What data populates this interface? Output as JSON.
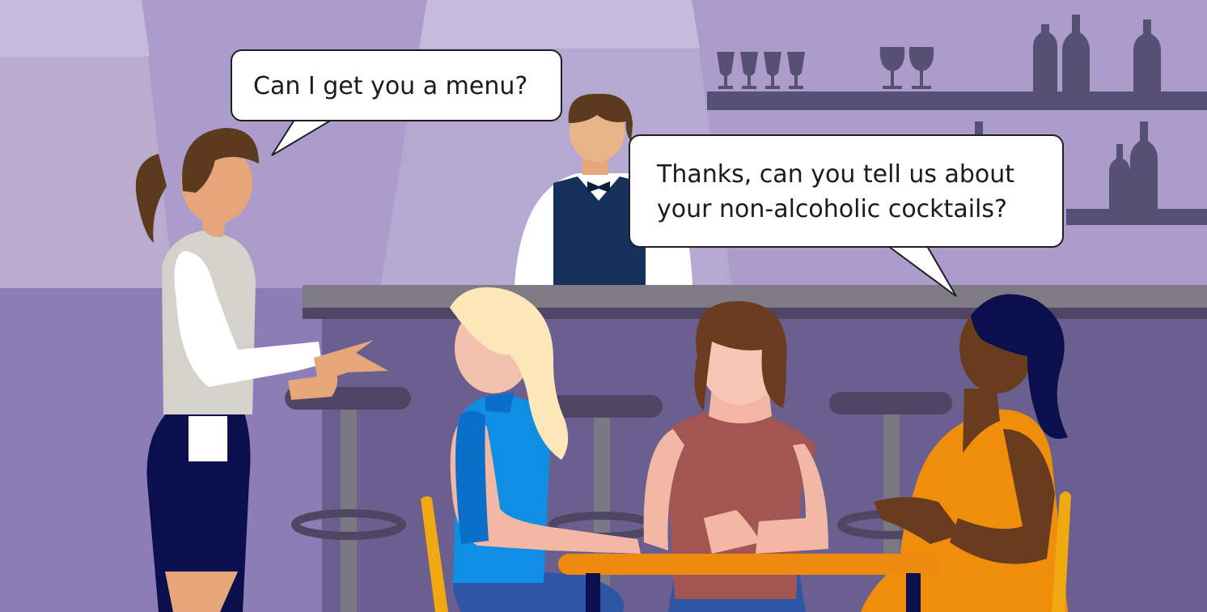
{
  "speech": {
    "waitress": "Can I get you a menu?",
    "customer_line1": "Thanks, can you tell us about",
    "customer_line2": "your non-alcoholic cocktails?"
  },
  "colors": {
    "wall": "#ab9ccb",
    "floor": "#8c7db7",
    "bar_front": "#6a5f8f",
    "counter": "#7e7b85",
    "shelf": "#565075",
    "table": "#ee8a0f",
    "waitress_skirt": "#0c0f4d",
    "bartender_vest": "#16315a",
    "blonde_shirt": "#0f8fe4",
    "center_shirt": "#a35651",
    "right_dress": "#ee8e0b"
  }
}
